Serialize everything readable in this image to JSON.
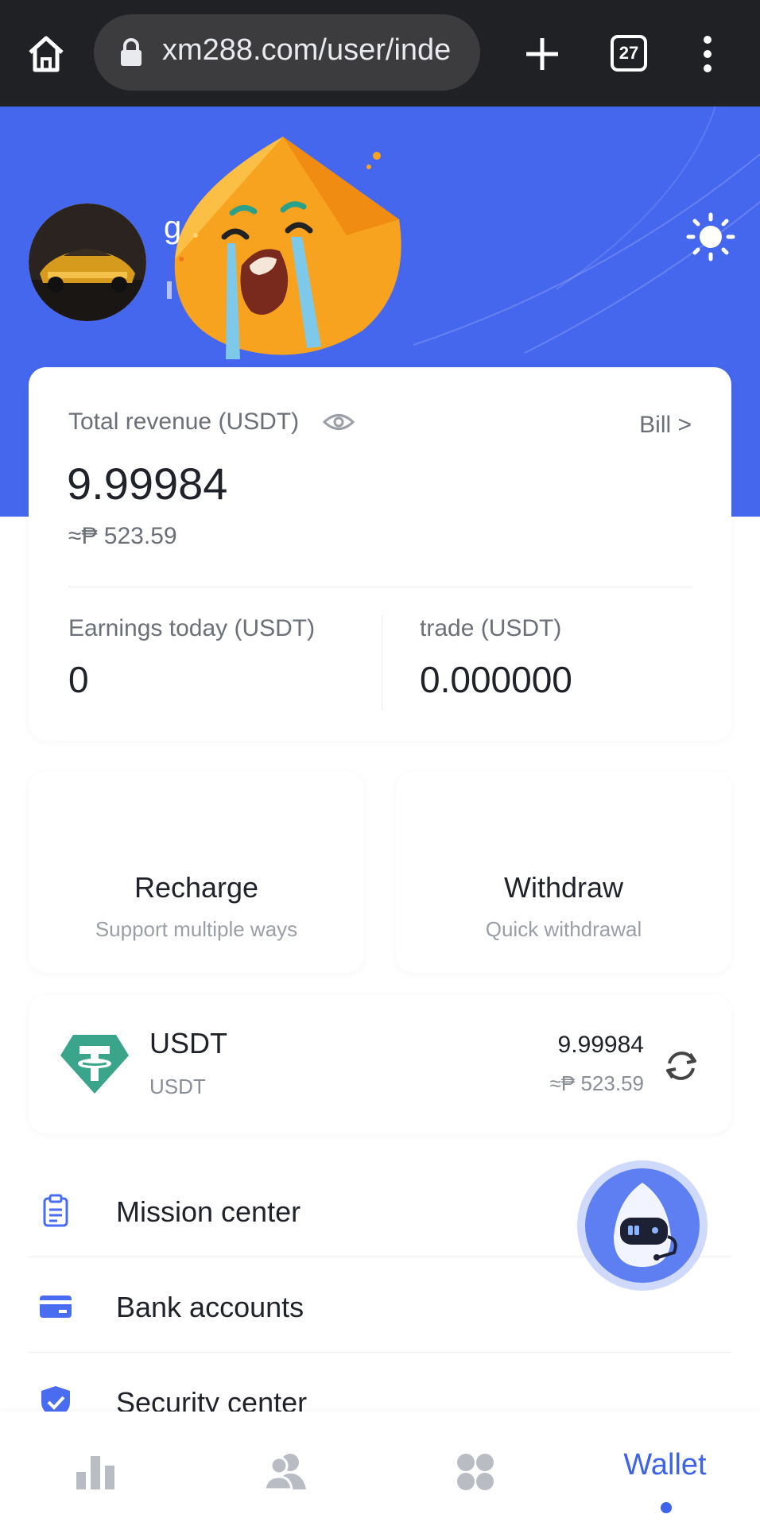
{
  "browser": {
    "url": "xm288.com/user/inde",
    "tab_count": "27",
    "icons": [
      "home-icon",
      "lock-icon",
      "new-tab-icon",
      "tabs-icon",
      "more-icon"
    ]
  },
  "header": {
    "username_partial": "g",
    "theme_icon": "sun-icon",
    "colors": {
      "brand_blue": "#4567ee"
    }
  },
  "revenue": {
    "label": "Total revenue (USDT)",
    "bill_link": "Bill >",
    "value": "9.99984",
    "fiat": "≈₱ 523.59",
    "earnings_today_label": "Earnings today (USDT)",
    "earnings_today_value": "0",
    "trade_label": "trade (USDT)",
    "trade_value": "0.000000"
  },
  "actions": [
    {
      "title": "Recharge",
      "subtitle": "Support multiple ways"
    },
    {
      "title": "Withdraw",
      "subtitle": "Quick withdrawal"
    }
  ],
  "asset": {
    "name": "USDT",
    "subname": "USDT",
    "amount": "9.99984",
    "fiat": "≈₱ 523.59",
    "icon": "tether-icon"
  },
  "menu": [
    {
      "label": "Mission center",
      "icon": "clipboard-icon"
    },
    {
      "label": "Bank accounts",
      "icon": "card-icon"
    },
    {
      "label": "Security center",
      "icon": "shield-check-icon"
    }
  ],
  "nav": {
    "items": [
      "chart-icon",
      "users-icon",
      "apps-icon"
    ],
    "active_label": "Wallet",
    "accent": "#3d63ea"
  }
}
